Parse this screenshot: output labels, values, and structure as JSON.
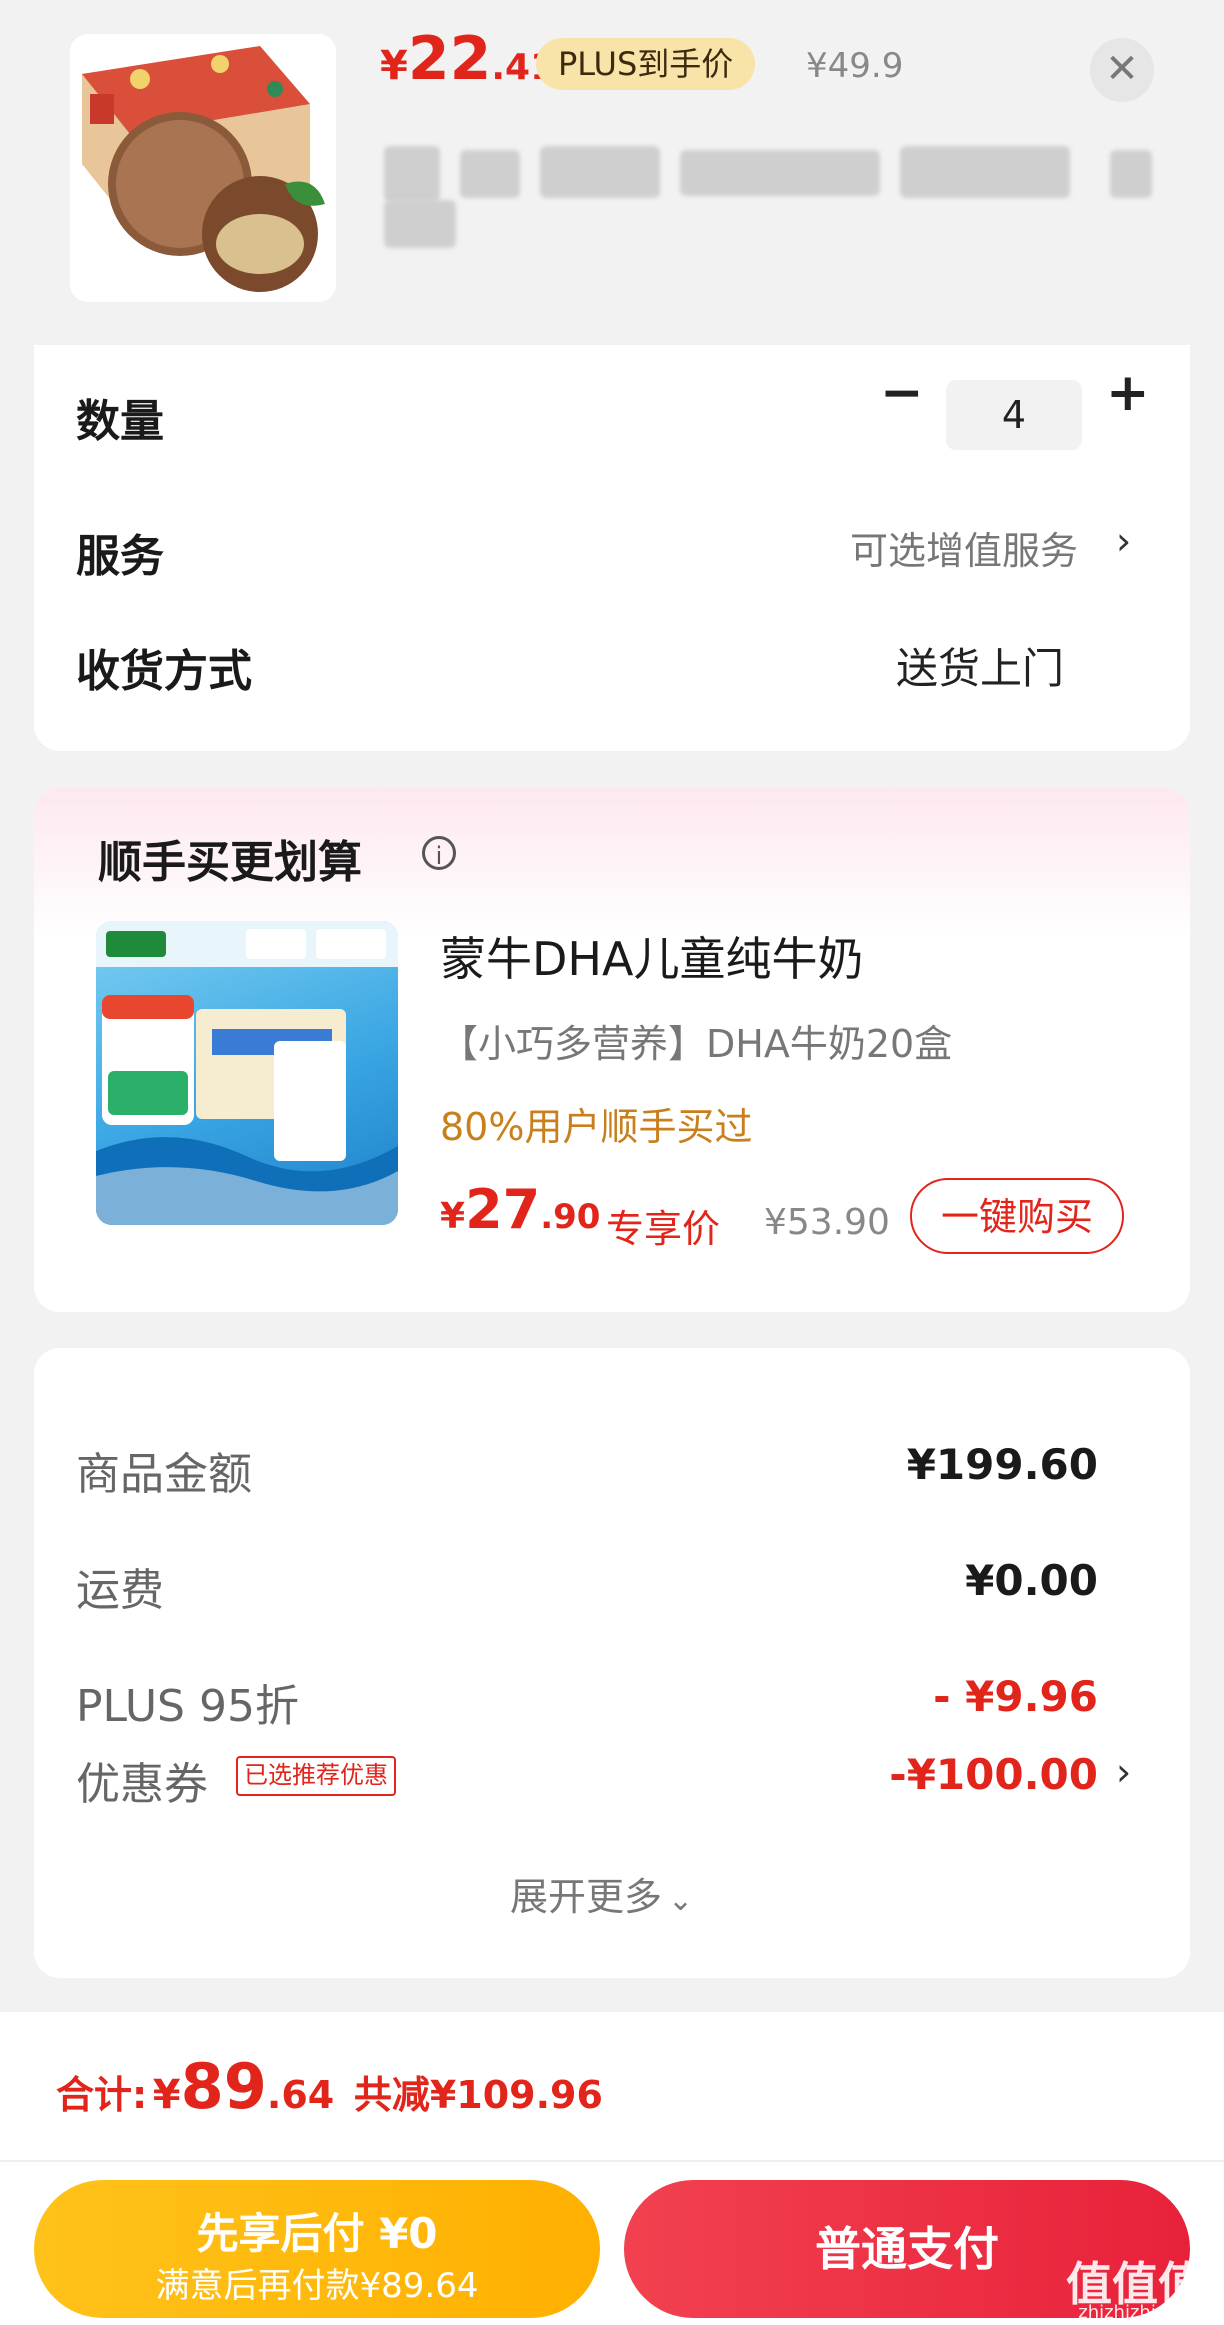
{
  "product": {
    "price_currency": "¥",
    "price_int": "22",
    "price_dec": ".41",
    "plus_badge": "PLUS到手价",
    "original_price": "¥49.9"
  },
  "options": {
    "quantity_label": "数量",
    "quantity_value": "4",
    "minus_symbol": "−",
    "plus_symbol": "+",
    "service_label": "服务",
    "service_value": "可选增值服务",
    "delivery_label": "收货方式",
    "delivery_value": "送货上门"
  },
  "recommend": {
    "title": "顺手买更划算",
    "item_name": "蒙牛DHA儿童纯牛奶",
    "item_subtitle": "【小巧多营养】DHA牛奶20盒",
    "hint": "80%用户顺手买过",
    "price_currency": "¥",
    "price_int": "27",
    "price_dec": ".90",
    "exclusive_label": "专享价",
    "original_price": "¥53.90",
    "buy_button": "一键购买"
  },
  "summary": {
    "rows": [
      {
        "label": "商品金额",
        "value": "¥199.60"
      },
      {
        "label": "运费",
        "value": "¥0.00"
      },
      {
        "label": "PLUS 95折",
        "value": "- ¥9.96"
      },
      {
        "label": "优惠券",
        "value": "-¥100.00"
      }
    ],
    "coupon_tag": "已选推荐优惠",
    "expand_more": "展开更多"
  },
  "footer": {
    "total_label": "合计:",
    "total_currency": "¥",
    "total_int": "89",
    "total_dec": ".64",
    "saved": "共减¥109.96",
    "paylater_title": "先享后付 ¥0",
    "paylater_sub": "满意后再付款¥89.64",
    "pay_button": "普通支付"
  },
  "watermark": {
    "logo": "值值值",
    "site": "zhizhizhi.com"
  },
  "colors": {
    "accent_red": "#e1251b",
    "gold": "#ffb000",
    "hint_orange": "#c9801c"
  }
}
